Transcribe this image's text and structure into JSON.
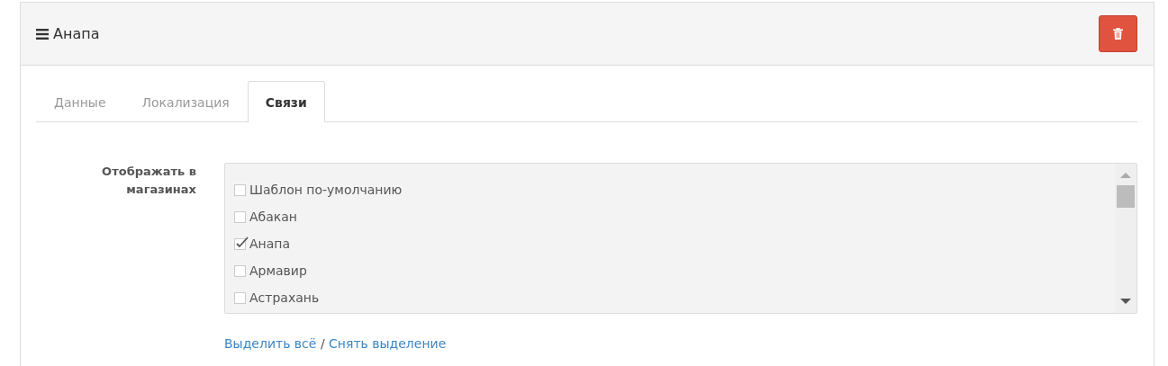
{
  "panel": {
    "title": "Анапа"
  },
  "tabs": [
    {
      "label": "Данные",
      "selected": false
    },
    {
      "label": "Локализация",
      "selected": false
    },
    {
      "label": "Связи",
      "selected": true
    }
  ],
  "form": {
    "label": "Отображать в магазинах",
    "stores": [
      {
        "name": "Шаблон по-умолчанию",
        "checked": false
      },
      {
        "name": "Абакан",
        "checked": false
      },
      {
        "name": "Анапа",
        "checked": true
      },
      {
        "name": "Армавир",
        "checked": false
      },
      {
        "name": "Астрахань",
        "checked": false
      }
    ],
    "select_all": "Выделить всё",
    "separator": "/",
    "deselect_all": "Снять выделение"
  }
}
